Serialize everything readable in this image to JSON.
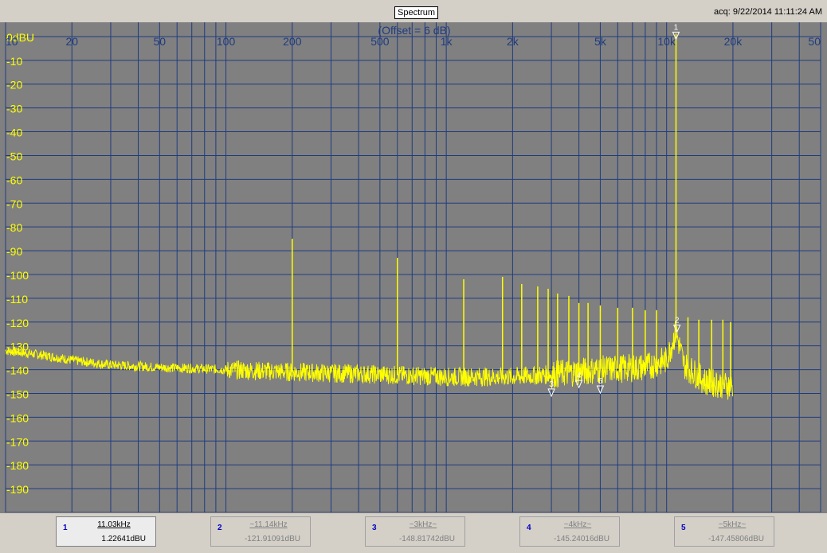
{
  "window": {
    "title_button": "Spectrum",
    "acq_label": "acq: 9/22/2014 11:11:24 AM",
    "offset_label": "(Offset = 6 dB)"
  },
  "colors": {
    "plot_bg": "#808080",
    "grid": "#1f3b7f",
    "trace": "#ffff00",
    "label": "#ffff00",
    "offset_text": "#1f3b7f"
  },
  "chart_data": {
    "type": "line",
    "title": "Spectrum",
    "xscale": "log",
    "xlim": [
      10,
      50000
    ],
    "ylim": [
      -200,
      6
    ],
    "x_ticks": [
      {
        "v": 10,
        "label": "10"
      },
      {
        "v": 20,
        "label": "20"
      },
      {
        "v": 50,
        "label": "50"
      },
      {
        "v": 100,
        "label": "100"
      },
      {
        "v": 200,
        "label": "200"
      },
      {
        "v": 500,
        "label": "500"
      },
      {
        "v": 1000,
        "label": "1k"
      },
      {
        "v": 2000,
        "label": "2k"
      },
      {
        "v": 5000,
        "label": "5k"
      },
      {
        "v": 10000,
        "label": "10k"
      },
      {
        "v": 20000,
        "label": "20k"
      },
      {
        "v": 50000,
        "label": "50"
      }
    ],
    "y_ticks": [
      {
        "v": 0,
        "label": "0dBU"
      },
      {
        "v": -10,
        "label": "-10"
      },
      {
        "v": -20,
        "label": "-20"
      },
      {
        "v": -30,
        "label": "-30"
      },
      {
        "v": -40,
        "label": "-40"
      },
      {
        "v": -50,
        "label": "-50"
      },
      {
        "v": -60,
        "label": "-60"
      },
      {
        "v": -70,
        "label": "-70"
      },
      {
        "v": -80,
        "label": "-80"
      },
      {
        "v": -90,
        "label": "-90"
      },
      {
        "v": -100,
        "label": "-100"
      },
      {
        "v": -110,
        "label": "-110"
      },
      {
        "v": -120,
        "label": "-120"
      },
      {
        "v": -130,
        "label": "-130"
      },
      {
        "v": -140,
        "label": "-140"
      },
      {
        "v": -150,
        "label": "-150"
      },
      {
        "v": -160,
        "label": "-160"
      },
      {
        "v": -170,
        "label": "-170"
      },
      {
        "v": -180,
        "label": "-180"
      },
      {
        "v": -190,
        "label": "-190"
      }
    ],
    "noise_floor": [
      [
        10,
        -132
      ],
      [
        15,
        -134
      ],
      [
        20,
        -136
      ],
      [
        30,
        -138
      ],
      [
        50,
        -139
      ],
      [
        100,
        -140
      ],
      [
        200,
        -141
      ],
      [
        500,
        -142
      ],
      [
        1000,
        -143
      ],
      [
        2000,
        -143
      ],
      [
        3000,
        -142
      ],
      [
        5000,
        -140
      ],
      [
        8000,
        -139
      ],
      [
        10000,
        -136
      ],
      [
        11030,
        -124
      ],
      [
        12000,
        -138
      ],
      [
        15000,
        -145
      ],
      [
        20000,
        -147
      ]
    ],
    "spikes": [
      [
        11030,
        1.2
      ],
      [
        200,
        -85
      ],
      [
        600,
        -93
      ],
      [
        1200,
        -102
      ],
      [
        1800,
        -101
      ],
      [
        2200,
        -104
      ],
      [
        2600,
        -105
      ],
      [
        2900,
        -106
      ],
      [
        3200,
        -108
      ],
      [
        3600,
        -109
      ],
      [
        4000,
        -112
      ],
      [
        4400,
        -112
      ],
      [
        5000,
        -113
      ],
      [
        6000,
        -114
      ],
      [
        7000,
        -114
      ],
      [
        8000,
        -115
      ],
      [
        9000,
        -115
      ],
      [
        12500,
        -118
      ],
      [
        14000,
        -119
      ],
      [
        16000,
        -119
      ],
      [
        18000,
        -119
      ],
      [
        19500,
        -120
      ]
    ],
    "grid": true
  },
  "markers": [
    {
      "num": "1",
      "freq": "11.03kHz",
      "value": "1.22641dBU",
      "active": true,
      "x": 11030,
      "y": 1.2
    },
    {
      "num": "2",
      "freq": "~11.14kHz",
      "value": "-121.91091dBU",
      "active": false,
      "x": 11140,
      "y": -121.9
    },
    {
      "num": "3",
      "freq": "~3kHz~",
      "value": "-148.81742dBU",
      "active": false,
      "x": 3000,
      "y": -148.8
    },
    {
      "num": "4",
      "freq": "~4kHz~",
      "value": "-145.24016dBU",
      "active": false,
      "x": 4000,
      "y": -145.2
    },
    {
      "num": "5",
      "freq": "~5kHz~",
      "value": "-147.45806dBU",
      "active": false,
      "x": 5000,
      "y": -147.5
    }
  ]
}
